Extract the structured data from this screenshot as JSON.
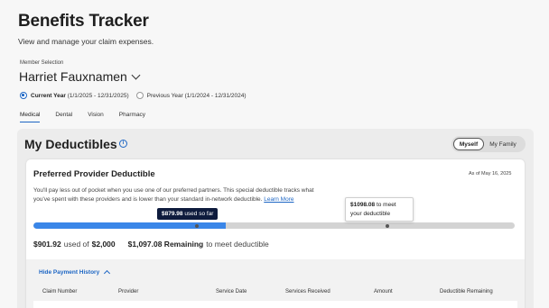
{
  "header": {
    "title": "Benefits Tracker",
    "subtitle": "View and manage your claim expenses."
  },
  "member": {
    "label": "Member Selection",
    "name": "Harriet Fauxnamen"
  },
  "year_options": {
    "current": "Current Year",
    "current_range": "(1/1/2025 - 12/31/2025)",
    "previous": "Previous Year (1/1/2024 - 12/31/2024)"
  },
  "tabs": [
    {
      "label": "Medical"
    },
    {
      "label": "Dental"
    },
    {
      "label": "Vision"
    },
    {
      "label": "Pharmacy"
    }
  ],
  "deductibles": {
    "title": "My Deductibles",
    "info_icon": "i",
    "toggle_on": "Myself",
    "toggle_off": "My Family"
  },
  "card": {
    "title": "Preferred Provider Deductible",
    "as_of": "As of May 16, 2025",
    "description": "You'll pay less out of pocket when you use one of our preferred partners. This special deductible tracks what you've spent with these providers and is lower than your standard in-network deductible.",
    "learn_more": "Learn More",
    "progress_fraction": 0.4,
    "tooltip_used_amount": "$879.98",
    "tooltip_used_text": "used so far",
    "tooltip_meet_amount": "$1098.08",
    "tooltip_meet_text": "to meet your deductible",
    "used": "$901.92",
    "used_of": "used of",
    "total": "$2,000",
    "remaining": "$1,097.08 Remaining",
    "remaining_suffix": "to meet deductible"
  },
  "history": {
    "toggle_label": "Hide Payment History",
    "columns": [
      "Claim Number",
      "Provider",
      "Service Date",
      "Services Received",
      "Amount",
      "Deductible Remaining"
    ]
  },
  "colors": {
    "accent": "#1d66c4",
    "bar_fill": "#3a86e8",
    "tooltip_dark": "#0e1b3d"
  }
}
